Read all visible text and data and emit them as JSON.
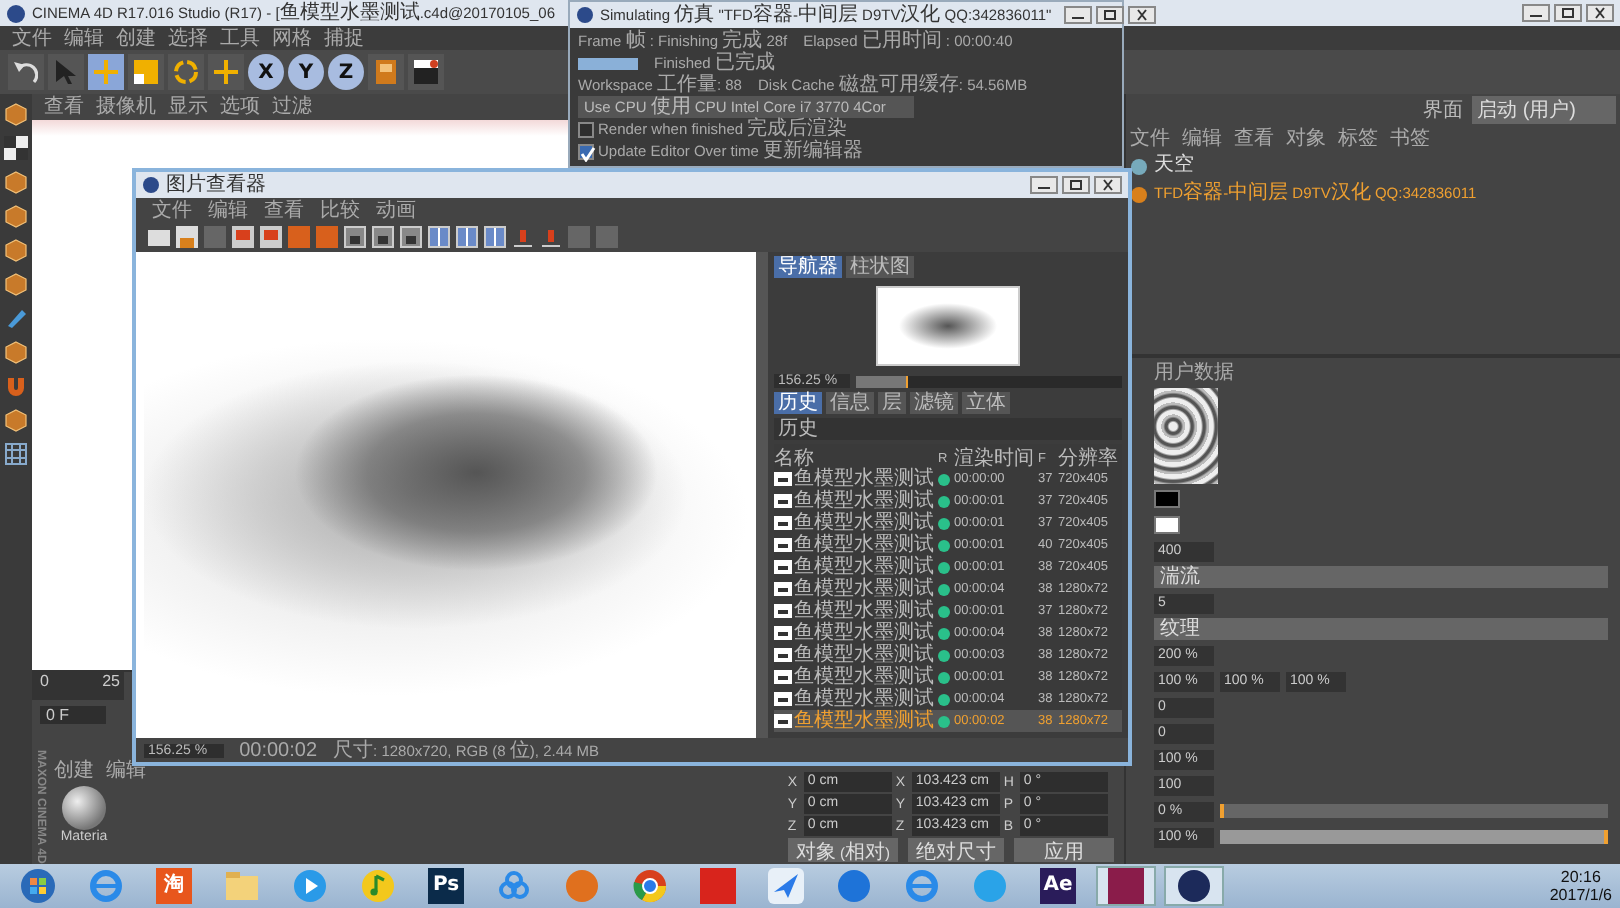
{
  "main_window": {
    "title": "CINEMA 4D R17.016 Studio (R17) - [鱼模型水墨测试.c4d@20170105_06",
    "menu": [
      "文件",
      "编辑",
      "创建",
      "选择",
      "工具",
      "网格",
      "捕捉"
    ],
    "toolbar": [
      {
        "kind": "undo",
        "selected": false
      },
      {
        "kind": "pointer",
        "selected": false
      },
      {
        "kind": "move",
        "selected": true
      },
      {
        "kind": "scale",
        "selected": false
      },
      {
        "kind": "rotate",
        "selected": false
      },
      {
        "kind": "add",
        "selected": false
      },
      {
        "kind": "axis",
        "label": "X",
        "selected": true
      },
      {
        "kind": "axis",
        "label": "Y",
        "selected": true
      },
      {
        "kind": "axis",
        "label": "Z",
        "selected": true
      },
      {
        "kind": "coords",
        "selected": false
      },
      {
        "kind": "clapper",
        "selected": false
      }
    ],
    "side_tools": [
      {
        "kind": "cube"
      },
      {
        "kind": "checker"
      },
      {
        "kind": "cube"
      },
      {
        "kind": "cube"
      },
      {
        "kind": "cube"
      },
      {
        "kind": "cube"
      },
      {
        "kind": "brush"
      },
      {
        "kind": "cube"
      },
      {
        "kind": "magnet"
      },
      {
        "kind": "cube"
      },
      {
        "kind": "grid"
      }
    ],
    "viewport_menu": [
      "查看",
      "摄像机",
      "显示",
      "选项",
      "过滤"
    ],
    "timeline": {
      "start": "0",
      "end": "25"
    },
    "frame_field": "0 F",
    "material_menu": [
      "创建",
      "编辑"
    ],
    "material": {
      "name": "Materia"
    },
    "logo": {
      "brand": "MAXON",
      "product": "CINEMA 4D"
    }
  },
  "object_manager": {
    "layout_label": "界面",
    "layout_value": "启动 (用户)",
    "menu": [
      "文件",
      "编辑",
      "查看",
      "对象",
      "标签",
      "书签"
    ],
    "objects": [
      {
        "name": "天空",
        "selected": false
      },
      {
        "name": "TFD容器-中间层 D9TV汉化 QQ:342836011",
        "selected": true
      }
    ]
  },
  "attributes": {
    "tabs": [
      "用户数据"
    ],
    "fields": [
      {
        "kind": "swatch",
        "color": "#000000"
      },
      {
        "kind": "swatch",
        "color": "#ffffff"
      },
      {
        "kind": "number",
        "value": "400"
      },
      {
        "kind": "dropdown",
        "value": "湍流"
      },
      {
        "kind": "number",
        "value": "5"
      },
      {
        "kind": "dropdown",
        "value": "纹理"
      },
      {
        "kind": "number",
        "value": "200 %"
      },
      {
        "kind": "triple",
        "values": [
          "100 %",
          "100 %",
          "100 %"
        ]
      },
      {
        "kind": "number",
        "value": "0"
      },
      {
        "kind": "number",
        "value": "0"
      },
      {
        "kind": "number",
        "value": "100 %"
      },
      {
        "kind": "number",
        "value": "100"
      },
      {
        "kind": "slider",
        "value": "0 %",
        "level": 0
      },
      {
        "kind": "slider",
        "value": "100 %",
        "level": 1
      }
    ]
  },
  "coordinates": {
    "rows": [
      {
        "axis": "X",
        "position": "0 cm",
        "size_axis": "X",
        "size": "103.423 cm",
        "rot_axis": "H",
        "rotation": "0 °"
      },
      {
        "axis": "Y",
        "position": "0 cm",
        "size_axis": "Y",
        "size": "103.423 cm",
        "rot_axis": "P",
        "rotation": "0 °"
      },
      {
        "axis": "Z",
        "position": "0 cm",
        "size_axis": "Z",
        "size": "103.423 cm",
        "rot_axis": "B",
        "rotation": "0 °"
      }
    ],
    "buttons": [
      {
        "kind": "dropdown",
        "label": "对象 (相对)"
      },
      {
        "kind": "dropdown",
        "label": "绝对尺寸"
      },
      {
        "kind": "button",
        "label": "应用"
      }
    ]
  },
  "simulation_window": {
    "title": "Simulating 仿真 \"TFD容器-中间层 D9TV汉化 QQ:342836011\"",
    "frame": "Frame 帧 : Finishing 完成 28f",
    "elapsed": "Elapsed 已用时间 : 00:00:40",
    "progress": {
      "level": 1
    },
    "status": "Finished 已完成",
    "workspace": "Workspace 工作量: 88",
    "disk_cache": "Disk Cache 磁盘可用缓存: 54.56MB",
    "device": "Use CPU 使用 CPU Intel Core i7 3770 4Cor",
    "options": [
      {
        "label": "Render when finished 完成后渲染",
        "checked": false
      },
      {
        "label": "Update Editor Over time 更新编辑器",
        "checked": true
      }
    ]
  },
  "picture_viewer": {
    "title": "图片查看器",
    "menu": [
      "文件",
      "编辑",
      "查看",
      "比较",
      "动画"
    ],
    "toolbar": [
      {
        "kind": "folder"
      },
      {
        "kind": "save"
      },
      {
        "kind": "blank"
      },
      {
        "kind": "render"
      },
      {
        "kind": "render"
      },
      {
        "kind": "stop"
      },
      {
        "kind": "stop"
      },
      {
        "kind": "frame"
      },
      {
        "kind": "frame"
      },
      {
        "kind": "frame"
      },
      {
        "kind": "compare"
      },
      {
        "kind": "compare"
      },
      {
        "kind": "compare"
      },
      {
        "kind": "marker"
      },
      {
        "kind": "marker"
      },
      {
        "kind": "blank"
      },
      {
        "kind": "blank"
      }
    ],
    "panel_tabs": [
      {
        "label": "导航器",
        "selected": true
      },
      {
        "label": "柱状图",
        "selected": false
      }
    ],
    "zoom": {
      "value": "156.25 %",
      "level": 0.2
    },
    "tabs": [
      {
        "label": "历史",
        "selected": true
      },
      {
        "label": "信息",
        "selected": false
      },
      {
        "label": "层",
        "selected": false
      },
      {
        "label": "滤镜",
        "selected": false
      },
      {
        "label": "立体",
        "selected": false
      }
    ],
    "history_title": "历史",
    "columns": [
      "名称",
      "R",
      "渲染时间",
      "F",
      "分辨率"
    ],
    "rows": [
      {
        "name": "鱼模型水墨测试",
        "time": "00:00:00",
        "f": "37",
        "res": "720x405",
        "selected": false
      },
      {
        "name": "鱼模型水墨测试",
        "time": "00:00:01",
        "f": "37",
        "res": "720x405",
        "selected": false
      },
      {
        "name": "鱼模型水墨测试",
        "time": "00:00:01",
        "f": "37",
        "res": "720x405",
        "selected": false
      },
      {
        "name": "鱼模型水墨测试",
        "time": "00:00:01",
        "f": "40",
        "res": "720x405",
        "selected": false
      },
      {
        "name": "鱼模型水墨测试",
        "time": "00:00:01",
        "f": "38",
        "res": "720x405",
        "selected": false
      },
      {
        "name": "鱼模型水墨测试",
        "time": "00:00:04",
        "f": "38",
        "res": "1280x72",
        "selected": false
      },
      {
        "name": "鱼模型水墨测试",
        "time": "00:00:01",
        "f": "37",
        "res": "1280x72",
        "selected": false
      },
      {
        "name": "鱼模型水墨测试",
        "time": "00:00:04",
        "f": "38",
        "res": "1280x72",
        "selected": false
      },
      {
        "name": "鱼模型水墨测试",
        "time": "00:00:03",
        "f": "38",
        "res": "1280x72",
        "selected": false
      },
      {
        "name": "鱼模型水墨测试",
        "time": "00:00:01",
        "f": "38",
        "res": "1280x72",
        "selected": false
      },
      {
        "name": "鱼模型水墨测试",
        "time": "00:00:04",
        "f": "38",
        "res": "1280x72",
        "selected": false
      },
      {
        "name": "鱼模型水墨测试",
        "time": "00:00:02",
        "f": "38",
        "res": "1280x72",
        "selected": true
      }
    ],
    "status": {
      "zoom": "156.25 %",
      "time": "00:00:02",
      "info": "尺寸: 1280x720, RGB (8 位), 2.44 MB"
    }
  },
  "taskbar": {
    "apps": [
      {
        "kind": "start",
        "selected": false
      },
      {
        "kind": "ie",
        "selected": false
      },
      {
        "kind": "tile",
        "label": "淘",
        "color": "#e8561c",
        "selected": false
      },
      {
        "kind": "folder",
        "selected": false
      },
      {
        "kind": "play",
        "selected": false
      },
      {
        "kind": "music",
        "selected": false
      },
      {
        "kind": "tile",
        "label": "Ps",
        "color": "#0b2b4a",
        "selected": false
      },
      {
        "kind": "cloud",
        "selected": false
      },
      {
        "kind": "orb",
        "color": "#e0701e",
        "selected": false
      },
      {
        "kind": "chrome",
        "selected": false
      },
      {
        "kind": "tile",
        "color": "#d8241c",
        "selected": false
      },
      {
        "kind": "bird",
        "selected": false
      },
      {
        "kind": "orb",
        "color": "#1e73d8",
        "selected": false
      },
      {
        "kind": "ie",
        "selected": false
      },
      {
        "kind": "orb",
        "color": "#2aa3e8",
        "selected": false
      },
      {
        "kind": "tile",
        "label": "Ae",
        "color": "#2a1c5a",
        "selected": false
      },
      {
        "kind": "tile",
        "color": "#8a1c4a",
        "selected": true
      },
      {
        "kind": "orb",
        "color": "#1c2a5a",
        "selected": true
      }
    ],
    "time": "20:16",
    "date": "2017/1/6"
  }
}
